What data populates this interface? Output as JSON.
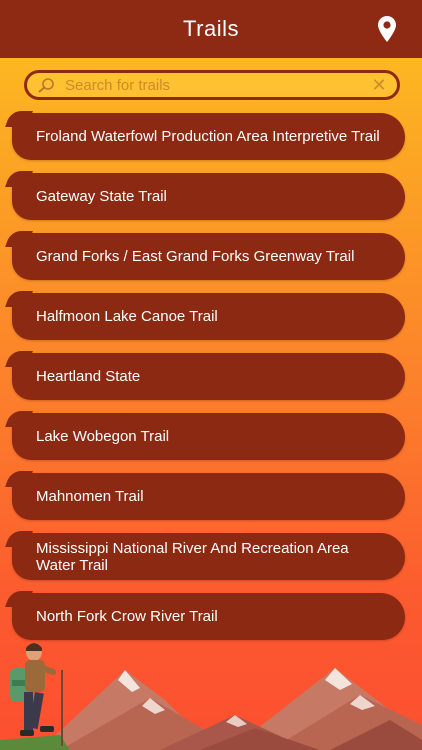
{
  "header": {
    "title": "Trails",
    "location_icon": "location-pin-icon"
  },
  "search": {
    "placeholder": "Search for trails",
    "value": "",
    "clear_symbol": "✕"
  },
  "trails": [
    "Froland Waterfowl Production Area Interpretive Trail",
    "Gateway State Trail",
    "Grand Forks / East Grand Forks Greenway Trail",
    "Halfmoon Lake Canoe Trail",
    "Heartland State",
    "Lake Wobegon Trail",
    "Mahnomen Trail",
    "Mississippi National River And Recreation Area Water Trail",
    "North Fork Crow River Trail"
  ],
  "colors": {
    "header": "#8e2a14",
    "item": "#8b2912",
    "gradient_top": "#fdc21f",
    "gradient_bottom": "#fc4f30"
  }
}
